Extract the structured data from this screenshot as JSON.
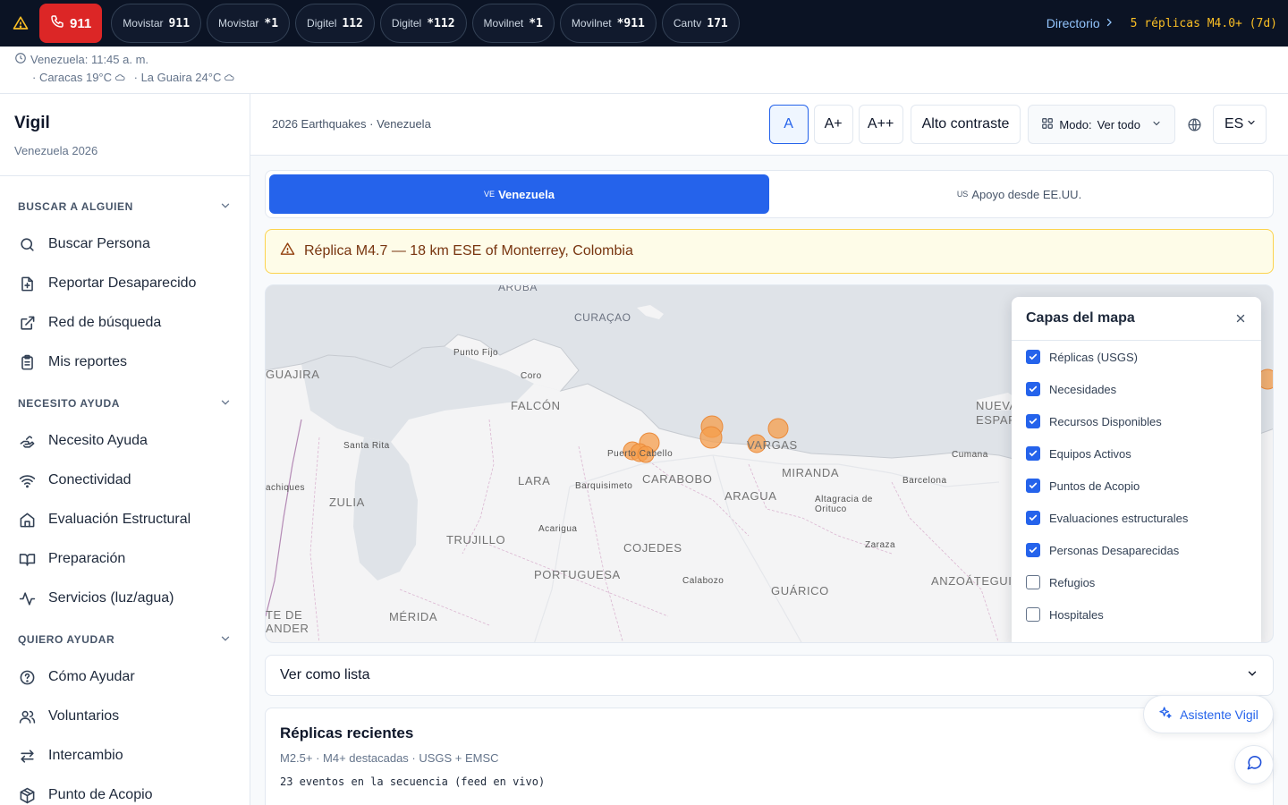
{
  "topbar": {
    "emergency_label": "911",
    "carriers": [
      {
        "name": "Movistar",
        "number": "911"
      },
      {
        "name": "Movistar",
        "number": "*1"
      },
      {
        "name": "Digitel",
        "number": "112"
      },
      {
        "name": "Digitel",
        "number": "*112"
      },
      {
        "name": "Movilnet",
        "number": "*1"
      },
      {
        "name": "Movilnet",
        "number": "*911"
      },
      {
        "name": "Cantv",
        "number": "171"
      }
    ],
    "directorio": "Directorio",
    "replicas": "5 réplicas M4.0+ (7d)"
  },
  "info": {
    "time": "Venezuela: 11:45 a. m.",
    "weather": [
      "· Caracas 19°C",
      "· La Guaira 24°C"
    ]
  },
  "sidebar": {
    "title": "Vigil",
    "subtitle": "Venezuela 2026",
    "sections": [
      {
        "title": "BUSCAR A ALGUIEN",
        "items": [
          "Buscar Persona",
          "Reportar Desaparecido",
          "Red de búsqueda",
          "Mis reportes"
        ]
      },
      {
        "title": "NECESITO AYUDA",
        "items": [
          "Necesito Ayuda",
          "Conectividad",
          "Evaluación Estructural",
          "Preparación",
          "Servicios (luz/agua)"
        ]
      },
      {
        "title": "QUIERO AYUDAR",
        "items": [
          "Cómo Ayudar",
          "Voluntarios",
          "Intercambio",
          "Punto de Acopio"
        ]
      }
    ]
  },
  "toolbar": {
    "breadcrumb": "2026 Earthquakes · Venezuela",
    "font_a": "A",
    "font_a_plus": "A+",
    "font_a_plus_plus": "A++",
    "contrast": "Alto contraste",
    "mode_label": "Modo:",
    "mode_value": "Ver todo",
    "lang": "ES"
  },
  "tabs": [
    {
      "code": "VE",
      "label": "Venezuela",
      "active": true
    },
    {
      "code": "US",
      "label": "Apoyo desde EE.UU.",
      "active": false
    }
  ],
  "alert": "Réplica M4.7 — 18 km ESE of Monterrey, Colombia",
  "map": {
    "labels": {
      "aruba": "ARUBA",
      "curacao": "CURAÇAO",
      "guajira": "GUAJIRA",
      "falcon": "FALCÓN",
      "lara": "LARA",
      "carabobo": "CARABOBO",
      "aragua": "ARAGUA",
      "vargas": "VARGAS",
      "miranda": "MIRANDA",
      "zulia": "ZULIA",
      "trujillo": "TRUJILLO",
      "cojedes": "COJEDES",
      "portuguesa": "PORTUGUESA",
      "guarico": "GUÁRICO",
      "anzoategui": "ANZOÁTEGUI",
      "merida": "MÉRIDA",
      "nueva_esparta": "NUEVA ESPARTA",
      "tachira_frag": "TE DE ANDER",
      "punto_fijo": "Punto Fijo",
      "coro": "Coro",
      "santa_rita": "Santa Rita",
      "puerto_cabello": "Puerto Cabello",
      "barquisimeto": "Barquisimeto",
      "acarigua": "Acarigua",
      "cumana": "Cumana",
      "barcelona": "Barcelona",
      "altagracia": "Altagracia de Orituco",
      "zaraza": "Zaraza",
      "calabozo": "Calabozo",
      "machiques": "achiques"
    },
    "layers_title": "Capas del mapa",
    "layers": [
      {
        "label": "Réplicas (USGS)",
        "checked": true
      },
      {
        "label": "Necesidades",
        "checked": true
      },
      {
        "label": "Recursos Disponibles",
        "checked": true
      },
      {
        "label": "Equipos Activos",
        "checked": true
      },
      {
        "label": "Puntos de Acopio",
        "checked": true
      },
      {
        "label": "Evaluaciones estructurales",
        "checked": true
      },
      {
        "label": "Personas Desaparecidas",
        "checked": true
      },
      {
        "label": "Refugios",
        "checked": false
      },
      {
        "label": "Hospitales",
        "checked": false
      }
    ],
    "marker_color": "#f59e4b"
  },
  "list_toggle": "Ver como lista",
  "recent": {
    "title": "Réplicas recientes",
    "meta": "M2.5+ · M4+ destacadas · USGS + EMSC",
    "feed": "23 eventos en la secuencia (feed en vivo)"
  },
  "assistant": "Asistente Vigil"
}
